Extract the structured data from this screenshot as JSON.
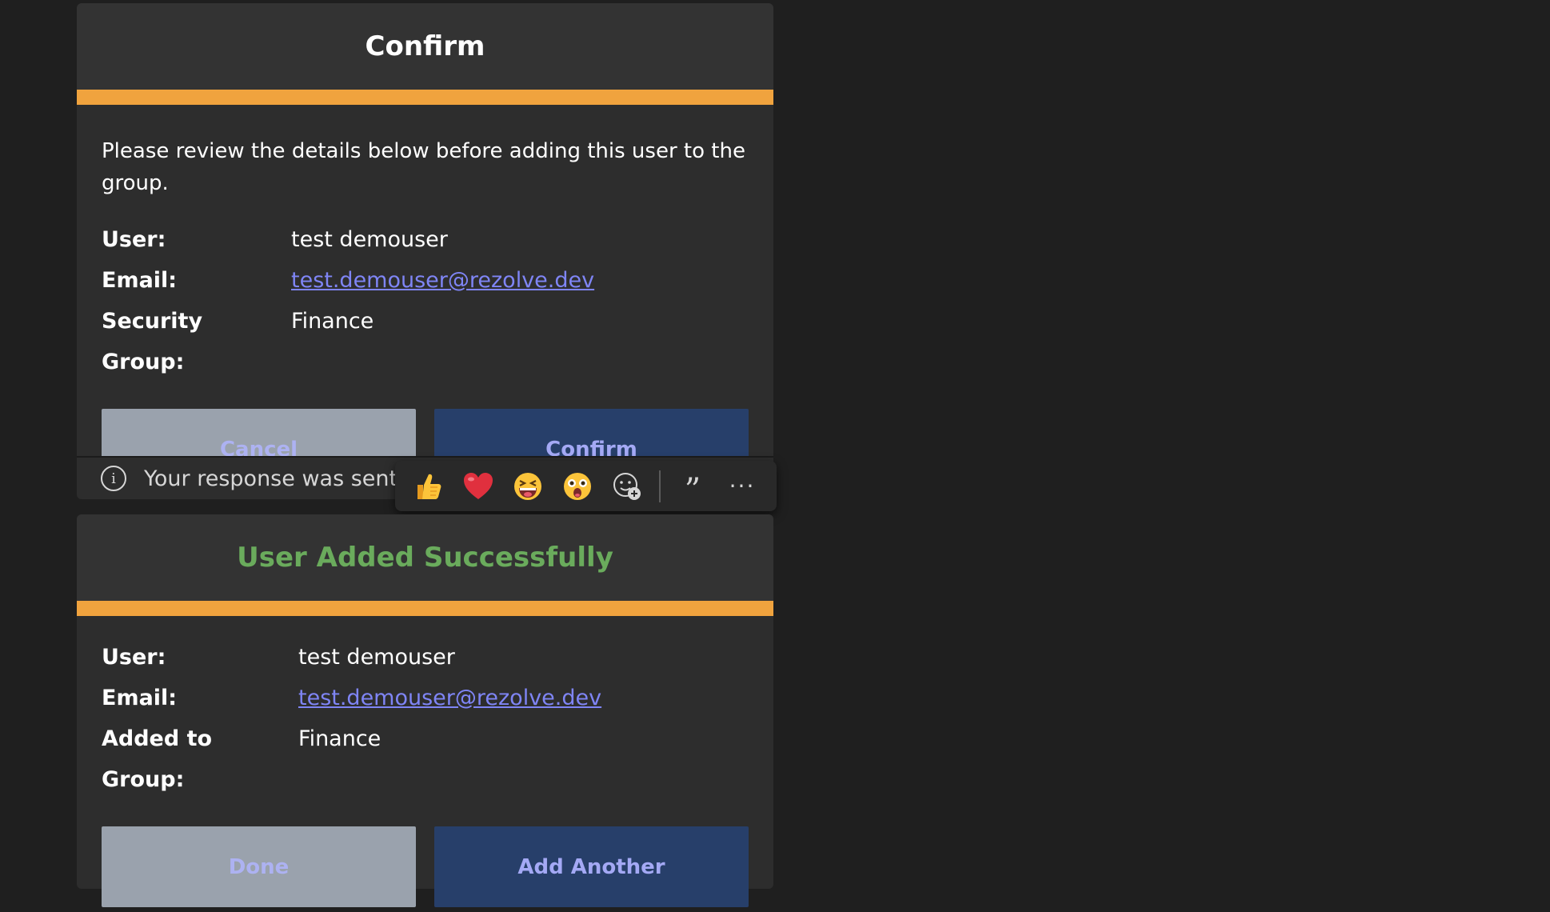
{
  "confirm_card": {
    "title": "Confirm",
    "intro": "Please review the details below before adding this user to the group.",
    "fields": [
      {
        "label": "User:",
        "value": "test demouser"
      },
      {
        "label": "Email:",
        "value": "test.demouser@rezolve.dev"
      },
      {
        "label": "Security Group:",
        "value": "Finance"
      }
    ],
    "cancel_label": "Cancel",
    "confirm_label": "Confirm",
    "response_notice": "Your response was sent t"
  },
  "reaction_bar": {
    "reactions": [
      "like",
      "heart",
      "laugh",
      "surprised"
    ],
    "add_reaction_icon": "add-reaction-icon",
    "quote_glyph": "”",
    "more_glyph": "···"
  },
  "success_card": {
    "title": "User Added Successfully",
    "fields": [
      {
        "label": "User:",
        "value": "test demouser"
      },
      {
        "label": "Email:",
        "value": "test.demouser@rezolve.dev"
      },
      {
        "label": "Added to Group:",
        "value": "Finance"
      }
    ],
    "done_label": "Done",
    "add_another_label": "Add Another"
  },
  "colors": {
    "background": "#1f1f1f",
    "card": "#2d2d2d",
    "accent": "#f0a33e",
    "success": "#6aab5c",
    "link": "#7f85f5",
    "primary_button": "#273f6a",
    "secondary_button": "#9aa2ad"
  }
}
